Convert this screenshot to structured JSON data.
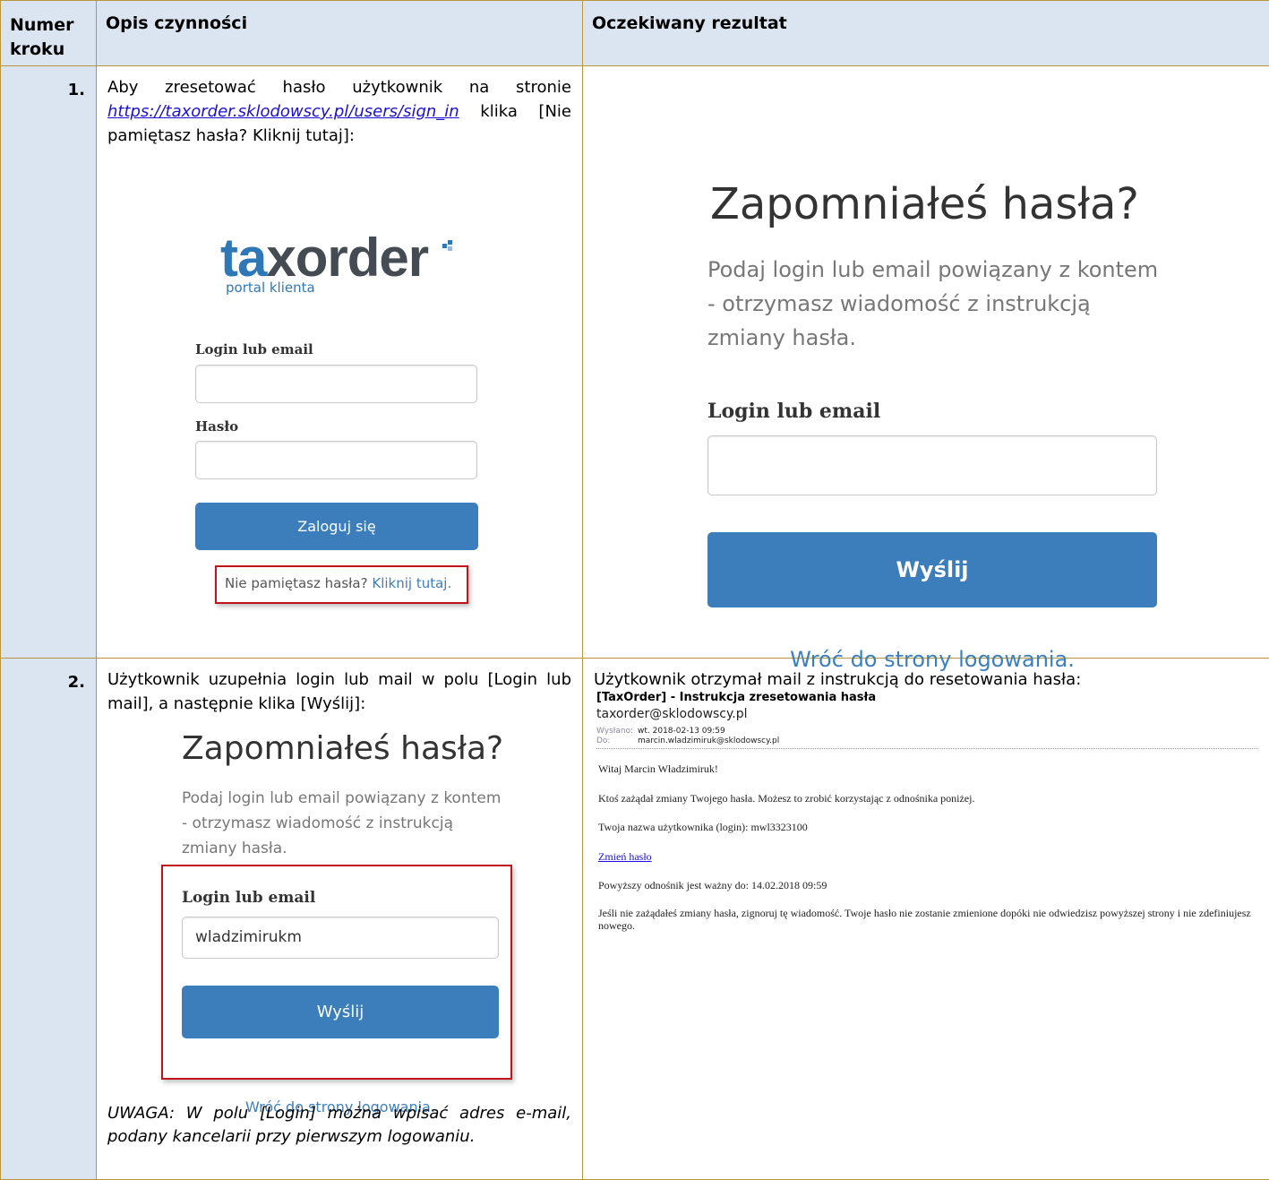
{
  "headers": {
    "step_number": "Numer kroku",
    "description": "Opis czynności",
    "expected_result": "Oczekiwany rezultat"
  },
  "step1": {
    "number": "1.",
    "desc_before_link": "Aby zresetować hasło użytkownik na stronie",
    "link": "https://taxorder.sklodowscy.pl/users/sign_in",
    "desc_after_link": "klika [Nie pamiętasz hasła? Kliknij tutaj]:",
    "login_form": {
      "logo_a": "ta",
      "logo_b": "xorder",
      "logo_sub": "portal klienta",
      "login_label": "Login lub email",
      "password_label": "Hasło",
      "login_button": "Zaloguj się",
      "forgot_text": "Nie pamiętasz hasła?",
      "forgot_link": "Kliknij tutaj."
    },
    "result_form": {
      "title": "Zapomniałeś hasła?",
      "subtitle_1": "Podaj login lub email powiązany z kontem",
      "subtitle_2": "- otrzymasz wiadomość z instrukcją",
      "subtitle_3": "zmiany hasła.",
      "login_label": "Login lub email",
      "send_button": "Wyślij",
      "back_link": "Wróć do strony logowania."
    }
  },
  "step2": {
    "number": "2.",
    "description": "Użytkownik uzupełnia login lub mail w polu [Login lub mail], a następnie klika [Wyślij]:",
    "form": {
      "title": "Zapomniałeś hasła?",
      "subtitle_1": "Podaj login lub email powiązany z kontem",
      "subtitle_2": "- otrzymasz wiadomość z instrukcją",
      "subtitle_3": "zmiany hasła.",
      "login_label": "Login lub email",
      "login_value": "wladzimirukm",
      "send_button": "Wyślij",
      "back_link": "Wróć do strony logowania."
    },
    "note": "UWAGA: W polu [Login] można wpisać adres e-mail, podany kancelarii przy pierwszym logowaniu.",
    "result_intro": "Użytkownik otrzymał mail z instrukcją do resetowania hasła:",
    "email": {
      "subject": "[TaxOrder] - Instrukcja zresetowania hasła",
      "from": "taxorder@sklodowscy.pl",
      "sent_label": "Wysłano:",
      "sent_value": "wt. 2018-02-13 09:59",
      "to_label": "Do:",
      "to_value": "marcin.wladzimiruk@sklodowscy.pl",
      "greeting": "Witaj Marcin Władzimiruk!",
      "line1": "Ktoś zażądał zmiany Twojego hasła. Możesz to zrobić korzystając z odnośnika poniżej.",
      "line2": "Twoja nazwa użytkownika (login): mwl3323100",
      "change_link": "Zmień hasło",
      "line3": "Powyższy odnośnik jest ważny do: 14.02.2018 09:59",
      "line4": "Jeśli nie zażądałeś zmiany hasła, zignoruj tę wiadomość. Twoje hasło nie zostanie zmienione dopóki nie odwiedzisz powyższej strony i nie zdefiniujesz nowego."
    }
  }
}
